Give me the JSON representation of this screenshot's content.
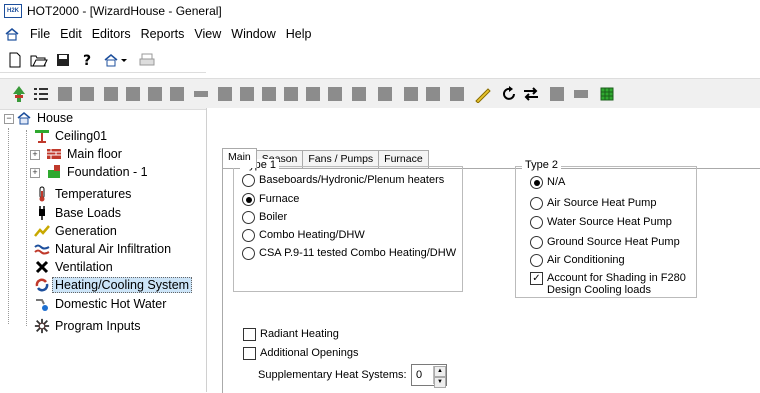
{
  "window": {
    "title": "HOT2000 - [WizardHouse - General]",
    "app_icon_text": "H2K"
  },
  "menu": [
    "File",
    "Edit",
    "Editors",
    "Reports",
    "View",
    "Window",
    "Help"
  ],
  "tree": {
    "root": "House",
    "items": [
      {
        "label": "Ceiling01",
        "icon": "ceiling-icon",
        "expandable": false
      },
      {
        "label": "Main floor",
        "icon": "floor-icon",
        "expandable": true
      },
      {
        "label": "Foundation - 1",
        "icon": "foundation-icon",
        "expandable": true
      },
      {
        "label": "Temperatures",
        "icon": "thermometer-icon",
        "expandable": false
      },
      {
        "label": "Base Loads",
        "icon": "plug-icon",
        "expandable": false
      },
      {
        "label": "Generation",
        "icon": "generation-icon",
        "expandable": false
      },
      {
        "label": "Natural Air Infiltration",
        "icon": "wind-icon",
        "expandable": false
      },
      {
        "label": "Ventilation",
        "icon": "fan-icon",
        "expandable": false
      },
      {
        "label": "Heating/Cooling System",
        "icon": "heating-cooling-icon",
        "expandable": false,
        "selected": true
      },
      {
        "label": "Domestic Hot Water",
        "icon": "hot-water-icon",
        "expandable": false
      },
      {
        "label": "Program Inputs",
        "icon": "program-inputs-icon",
        "expandable": false
      }
    ]
  },
  "tabs": [
    "Main",
    "Season",
    "Fans / Pumps",
    "Furnace"
  ],
  "active_tab": "Main",
  "type1": {
    "title": "Type 1",
    "options": [
      "Baseboards/Hydronic/Plenum heaters",
      "Furnace",
      "Boiler",
      "Combo Heating/DHW",
      "CSA P.9-11 tested Combo Heating/DHW"
    ],
    "selected": "Furnace"
  },
  "type2": {
    "title": "Type 2",
    "options": [
      "N/A",
      "Air Source Heat Pump",
      "Water Source Heat Pump",
      "Ground Source Heat Pump",
      "Air Conditioning"
    ],
    "selected": "N/A",
    "shading_label_line1": "Account for Shading in F280",
    "shading_label_line2": "Design Cooling loads",
    "shading_checked": true
  },
  "radiant_heating": {
    "label": "Radiant Heating",
    "checked": false
  },
  "additional_openings": {
    "label": "Additional Openings",
    "checked": false
  },
  "supplementary": {
    "label": "Supplementary Heat Systems:",
    "value": "0"
  },
  "colors": {
    "selection": "#cce4f7",
    "toolbar_bg": "#f0f0f0",
    "accent_green": "#2fa82f",
    "link_blue": "#1d4f9c"
  }
}
